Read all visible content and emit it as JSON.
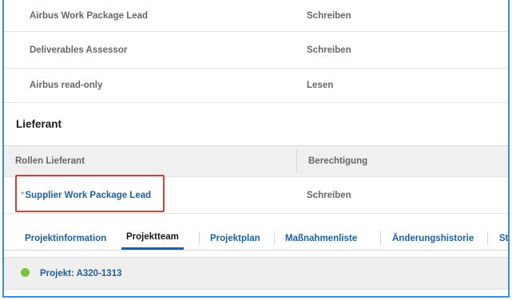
{
  "airbus_roles": [
    {
      "role": "Airbus Work Package Lead",
      "permission": "Schreiben"
    },
    {
      "role": "Deliverables Assessor",
      "permission": "Schreiben"
    },
    {
      "role": "Airbus read-only",
      "permission": "Lesen"
    }
  ],
  "supplier_section": {
    "title": "Lieferant",
    "col_role_header": "Rollen Lieferant",
    "col_permission_header": "Berechtigung",
    "rows": [
      {
        "required_marker": "*",
        "role": "Supplier Work Package Lead",
        "permission": "Schreiben"
      }
    ]
  },
  "tabs": [
    {
      "label": "Projektinformation",
      "active": false
    },
    {
      "label": "Projektteam",
      "active": true
    },
    {
      "label": "Projektplan",
      "active": false
    },
    {
      "label": "Maßnahmenliste",
      "active": false
    },
    {
      "label": "Änderungshistorie",
      "active": false
    },
    {
      "label": "St",
      "active": false
    }
  ],
  "project": {
    "label": "Projekt: A320-1313",
    "status_color": "#7cc242"
  },
  "colors": {
    "link": "#1f5f9f",
    "frame": "#3a8fd6",
    "highlight": "#e03b3b"
  }
}
